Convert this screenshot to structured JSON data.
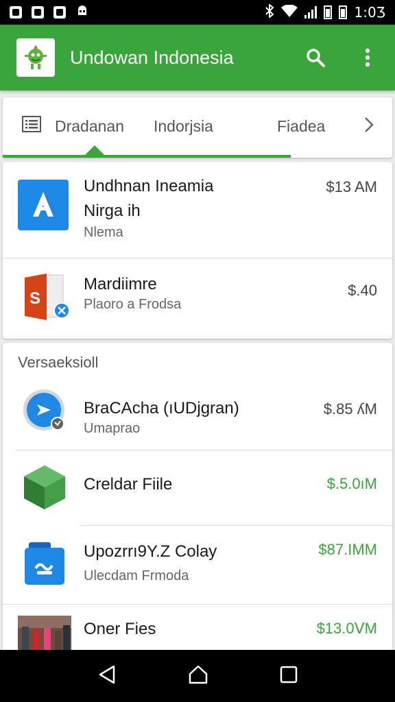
{
  "status_bar": {
    "time": "1:0Ӡ"
  },
  "app_bar": {
    "title": "Undowan Indonesia",
    "search_icon": "search-icon",
    "more_icon": "more-vert-icon"
  },
  "tabs": [
    {
      "label": "Dradanan",
      "icon": "list-icon"
    },
    {
      "label": "Indorjsia"
    },
    {
      "label": "Fiadea"
    }
  ],
  "card1": {
    "items": [
      {
        "title": "Undhnan Ineamia",
        "line2": "Nirga ih",
        "sub": "Nlema",
        "price": "$13 AM",
        "icon": "app-a-icon"
      },
      {
        "title": "Mardiimre",
        "sub": "Plaoro a Frodsa",
        "price": "$.40",
        "icon": "slides-s-icon"
      }
    ]
  },
  "card2": {
    "section_title": "Versaeksioll",
    "items": [
      {
        "title": "BraCAcha (ıUDjgran)",
        "sub": "Umaprao",
        "price": "$.85 ʎM",
        "icon": "play-circle-icon"
      },
      {
        "title": "Creldar Fiile",
        "price": "$.5.0ıM",
        "icon": "green-cube-icon"
      },
      {
        "title": "Upozrrı9Y.Z Colay",
        "sub": "Ulecdam Frmoda",
        "price": "$87.IMM",
        "icon": "blue-file-icon"
      },
      {
        "title": "Oner Fies",
        "price": "$13.0ᐯM",
        "icon": "photo-thumbnail"
      }
    ]
  },
  "nav": {
    "back": "back-icon",
    "home": "home-icon",
    "recents": "recents-icon"
  },
  "colors": {
    "brand_green": "#3aa53a"
  }
}
